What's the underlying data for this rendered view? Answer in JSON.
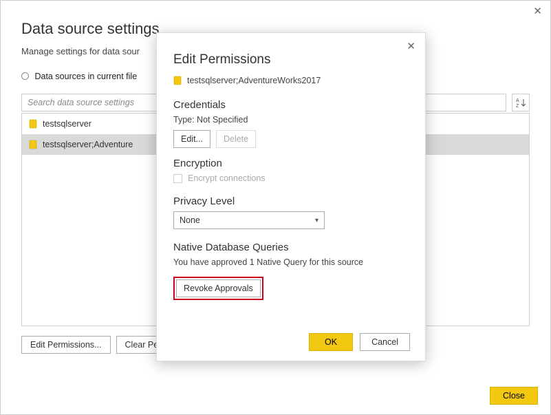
{
  "page": {
    "title": "Data source settings",
    "subtitle": "Manage settings for data sour",
    "radio_label": "Data sources in current file",
    "search_placeholder": "Search data source settings",
    "sort_glyph": "A↓Z"
  },
  "list": {
    "items": [
      {
        "label": "testsqlserver",
        "selected": false
      },
      {
        "label": "testsqlserver;Adventure",
        "selected": true
      }
    ]
  },
  "buttons": {
    "edit_permissions": "Edit Permissions...",
    "clear_permissions": "Clear Perm",
    "close": "Close"
  },
  "modal": {
    "title": "Edit Permissions",
    "source": "testsqlserver;AdventureWorks2017",
    "credentials": {
      "heading": "Credentials",
      "type_line": "Type: Not Specified",
      "edit": "Edit...",
      "delete": "Delete"
    },
    "encryption": {
      "heading": "Encryption",
      "checkbox_label": "Encrypt connections"
    },
    "privacy": {
      "heading": "Privacy Level",
      "selected": "None"
    },
    "native": {
      "heading": "Native Database Queries",
      "msg": "You have approved 1 Native Query for this source",
      "revoke": "Revoke Approvals"
    },
    "ok": "OK",
    "cancel": "Cancel"
  }
}
